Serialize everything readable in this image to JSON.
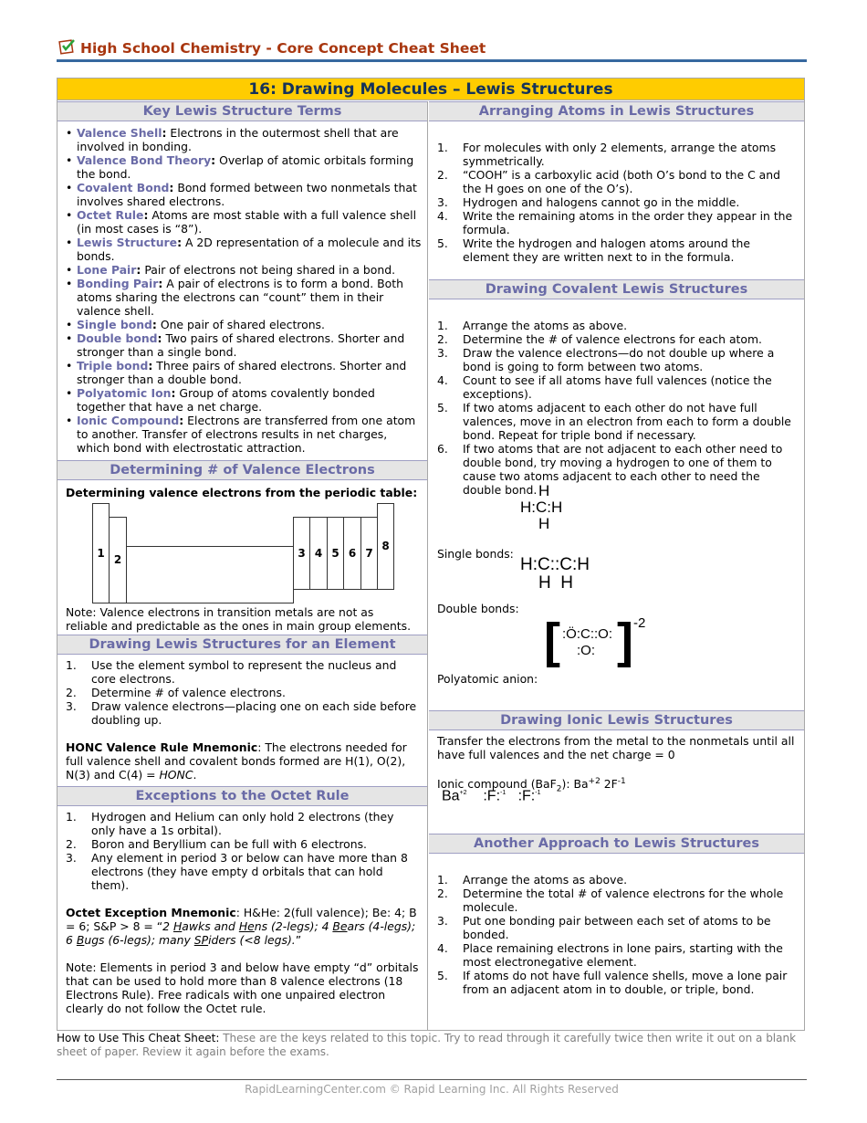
{
  "header": {
    "title": "High School Chemistry - Core Concept Cheat Sheet",
    "icon": "checklist-icon"
  },
  "banner": "16: Drawing Molecules – Lewis Structures",
  "left": {
    "key_terms": {
      "heading": "Key Lewis Structure Terms",
      "items": [
        {
          "term": "Valence Shell",
          "def": " Electrons in the outermost shell that are involved in bonding."
        },
        {
          "term": "Valence Bond Theory",
          "def": " Overlap of atomic orbitals forming the bond."
        },
        {
          "term": "Covalent Bond",
          "def": " Bond formed between two nonmetals that involves shared electrons."
        },
        {
          "term": "Octet Rule",
          "def": " Atoms are most stable with a full valence shell (in most cases is “8”)."
        },
        {
          "term": "Lewis Structure",
          "def": " A 2D representation of a molecule and its bonds."
        },
        {
          "term": "Lone Pair",
          "def": " Pair of electrons not being shared in a bond."
        },
        {
          "term": "Bonding Pair",
          "def": " A pair of electrons is to form a bond.  Both atoms sharing the electrons can “count” them in their valence shell."
        },
        {
          "term": "Single bond",
          "def": " One pair of shared electrons."
        },
        {
          "term": "Double bond",
          "def": " Two pairs of shared electrons.  Shorter and stronger than a single bond."
        },
        {
          "term": "Triple bond",
          "def": " Three pairs of shared electrons.  Shorter and stronger than a double bond."
        },
        {
          "term": "Polyatomic Ion",
          "def": " Group of atoms covalently bonded together that have a net charge."
        },
        {
          "term": "Ionic Compound",
          "def": "  Electrons are transferred from one atom to another.  Transfer of electrons results in net charges, which bond with electrostatic attraction."
        }
      ]
    },
    "valence": {
      "heading": "Determining # of Valence Electrons",
      "subheading": "Determining valence electrons from the periodic table:",
      "groups": [
        "1",
        "2",
        "3",
        "4",
        "5",
        "6",
        "7",
        "8"
      ],
      "note": "Note: Valence electrons in transition metals are not as reliable and predictable as the ones in main group elements."
    },
    "element": {
      "heading": "Drawing Lewis Structures for an Element",
      "steps": [
        "Use the element symbol to represent the nucleus and core electrons.",
        "Determine # of valence electrons.",
        "Draw valence electrons—placing one on each side before doubling up."
      ],
      "honc_label": "HONC Valence Rule Mnemonic",
      "honc_text": ": The electrons needed for full valence shell and covalent bonds formed are H(1), O(2), N(3) and C(4) = ",
      "honc_italic": "HONC",
      "honc_end": "."
    },
    "exceptions": {
      "heading": "Exceptions to the Octet Rule",
      "steps": [
        "Hydrogen and Helium can only hold 2 electrons (they only have a 1s orbital).",
        "Boron and Beryllium can be full with 6 electrons.",
        "Any element in period 3 or below can have more than 8 electrons (they have empty d orbitals that can hold them)."
      ],
      "mnemonic_label": "Octet Exception Mnemonic",
      "mnemonic_text": ": H&He: 2(full valence); Be: 4; B = 6; S&P > 8 = “",
      "note": "Note: Elements in period 3 and below have empty “d” orbitals that can be used to hold more than 8 valence electrons (18 Electrons Rule). Free radicals with one unpaired electron clearly do not follow the Octet rule."
    }
  },
  "right": {
    "arranging": {
      "heading": "Arranging Atoms in Lewis Structures",
      "steps": [
        "For molecules with only 2 elements, arrange the atoms symmetrically.",
        "“COOH” is a carboxylic acid (both O’s bond to the C and the H goes on one of the O’s).",
        "Hydrogen and halogens cannot go in the middle.",
        "Write the remaining atoms in the order they appear in the formula.",
        "Write the hydrogen and halogen atoms around the element they are written next to in the formula."
      ]
    },
    "covalent": {
      "heading": "Drawing Covalent Lewis Structures",
      "steps": [
        "Arrange the atoms as above.",
        "Determine the # of valence electrons for each atom.",
        "Draw the valence electrons—do not double up where a bond is going to form between two atoms.",
        "Count to see if all atoms have full valences (notice the exceptions).",
        "If two atoms adjacent to each other do not have full valences, move in an electron from each to form a double bond.  Repeat for triple bond if necessary.",
        "If two atoms that are not adjacent to each other need to double bond, try moving a hydrogen to one of them to cause two atoms adjacent to each other to need the double bond."
      ],
      "single_label": "Single bonds:",
      "double_label": "Double bonds:",
      "anion_label": "Polyatomic anion:",
      "anion_charge": "-2"
    },
    "ionic": {
      "heading": "Drawing Ionic Lewis Structures",
      "text": "Transfer the electrons from the metal to the nonmetals until all have full valences and the net charge = 0",
      "compound_label": "Ionic compound (BaF",
      "compound_sub": "2",
      "compound_mid": "): Ba",
      "ba_charge": "+2",
      "f_prefix": " 2F",
      "f_charge": "-1"
    },
    "another": {
      "heading": "Another Approach to Lewis Structures",
      "steps": [
        "Arrange the atoms as above.",
        "Determine the total # of valence electrons for the whole molecule.",
        "Put one bonding pair between each set of atoms to be bonded.",
        "Place remaining electrons in lone pairs, starting with the most electronegative element.",
        "If atoms do not have full valence shells, move a lone pair from an adjacent atom in to double, or triple, bond."
      ]
    }
  },
  "footnote": {
    "label": "How to Use This Cheat Sheet:",
    "text": " These are the keys related to this topic. Try to read through it carefully twice then write it out on a blank sheet of paper. Review it again before the exams."
  },
  "footer": "RapidLearningCenter.com   © Rapid Learning Inc. All Rights Reserved"
}
